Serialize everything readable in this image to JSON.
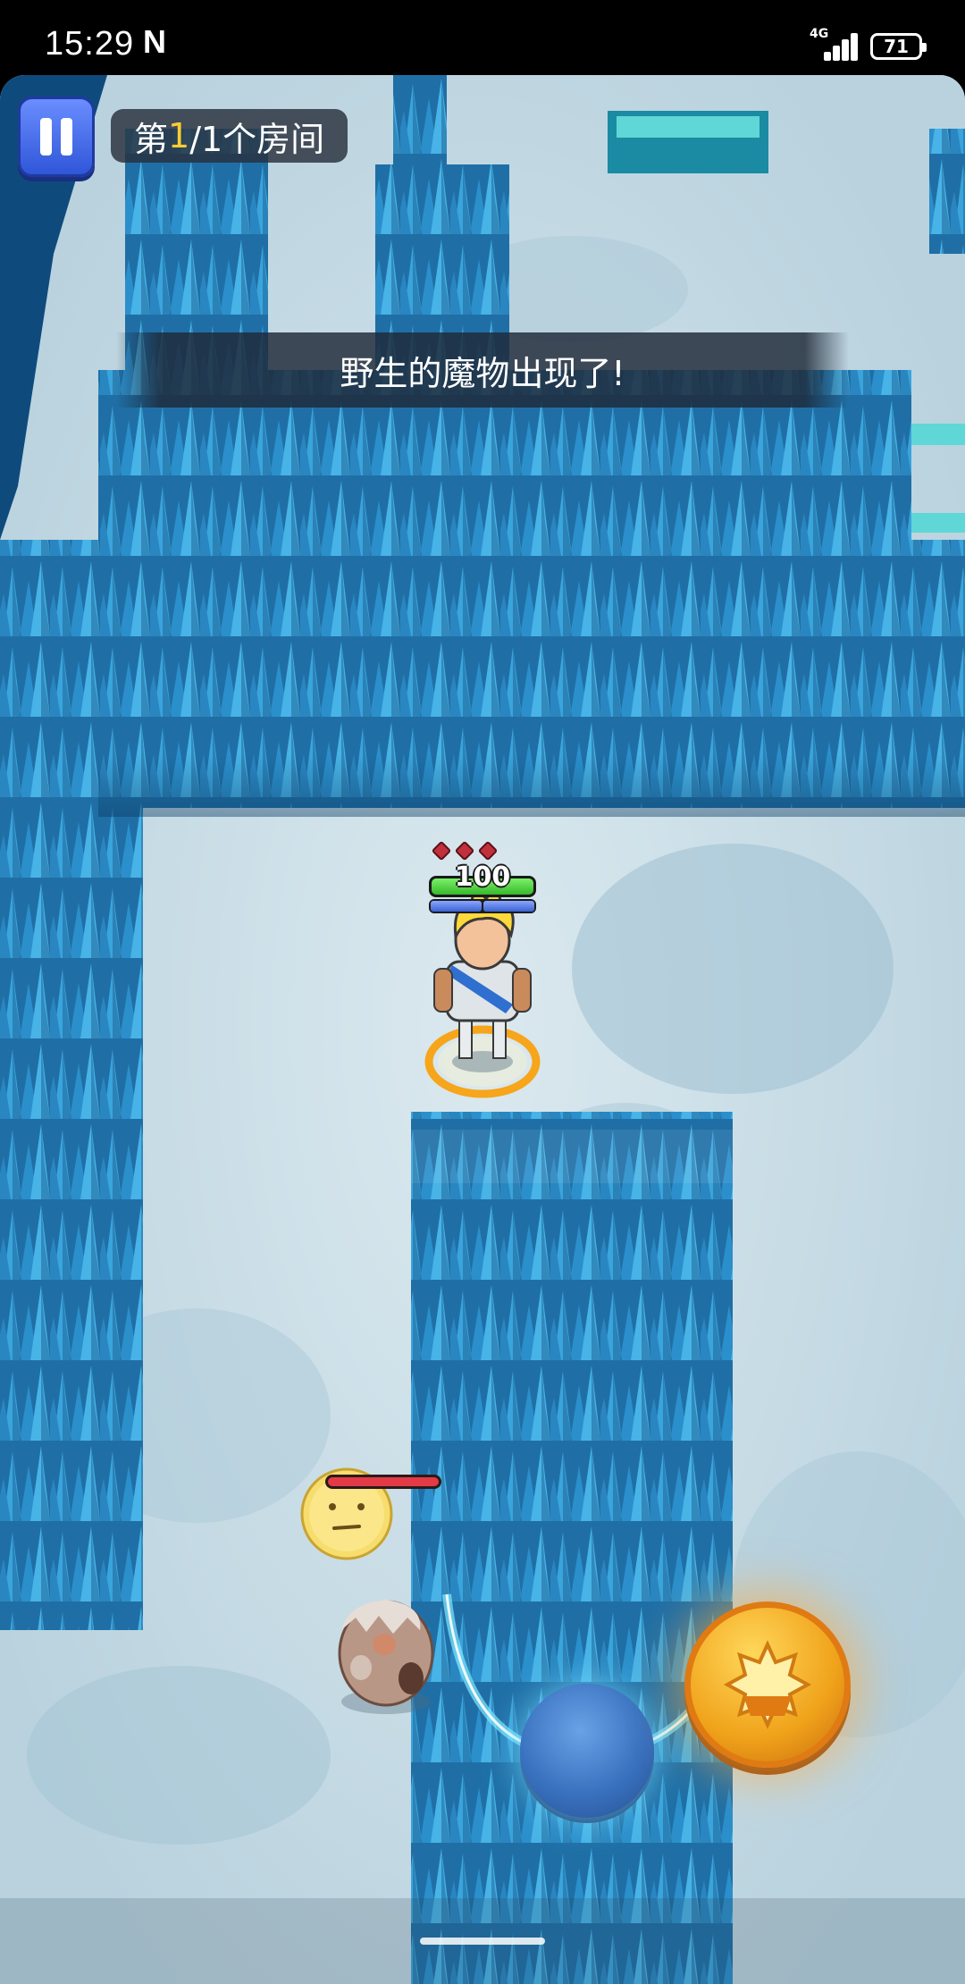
{
  "status_bar": {
    "time": "15:29",
    "carrier_icon": "N",
    "network": "4G",
    "battery": "71"
  },
  "hud": {
    "pause_icon": "pause-icon",
    "room_prefix": "第",
    "room_current": "1",
    "room_rest": "/1个房间",
    "notice": "野生的魔物出现了!",
    "player_hp": "100",
    "player_hp_fraction": 1.0,
    "player_ammo_count": 3,
    "enemy_hp_fraction": 1.0,
    "enemy_emote_icon": "neutral-face-emote-icon",
    "skill_icon": "gear-burst-skill-icon",
    "joystick_icon": "movement-joystick"
  },
  "colors": {
    "ice_floor": "#c9dde6",
    "ice_crystal": "#2f8fc6",
    "hp_green": "#37b82a",
    "mp_blue": "#3b63d0",
    "enemy_red": "#e23a46",
    "skill_gold": "#f0a21a"
  }
}
